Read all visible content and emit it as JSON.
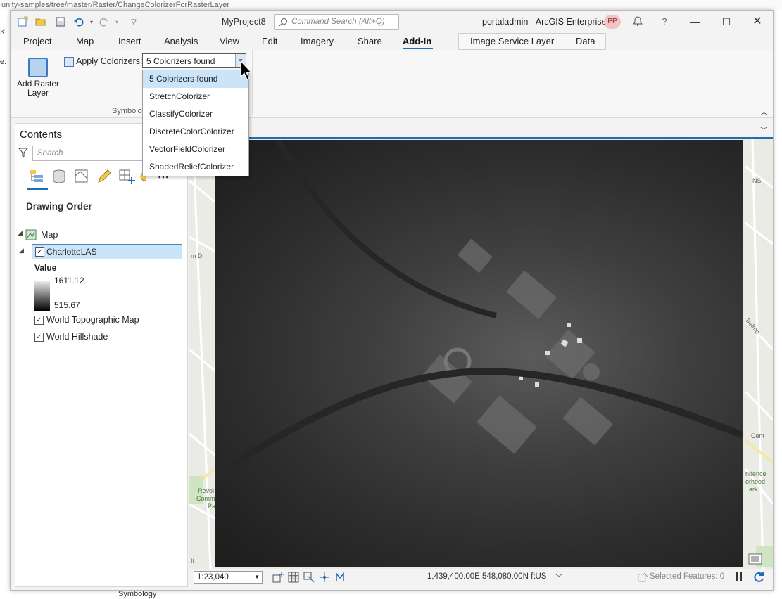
{
  "background": {
    "url_fragment": "unity-samples/tree/master/Raster/ChangeColorizerForRasterLayer",
    "left_edge_k": "K",
    "left_edge_e": "e.",
    "bottom_tab": "Symbology"
  },
  "titlebar": {
    "project": "MyProject8",
    "search_placeholder": "Command Search (Alt+Q)",
    "portal": "portaladmin - ArcGIS Enterprise",
    "avatar": "PP",
    "help": "?"
  },
  "tabs": [
    "Project",
    "Map",
    "Insert",
    "Analysis",
    "View",
    "Edit",
    "Imagery",
    "Share",
    "Add-In"
  ],
  "context_tabs": [
    "Image Service Layer",
    "Data"
  ],
  "ribbon": {
    "add_raster_label_1": "Add Raster",
    "add_raster_label_2": "Layer",
    "apply_label": "Apply Colorizers:",
    "combo_value": "5 Colorizers found",
    "group_label": "Symbolo"
  },
  "dropdown": [
    "5 Colorizers found",
    "StretchColorizer",
    "ClassifyColorizer",
    "DiscreteColorColorizer",
    "VectorFieldColorizer",
    "ShadedReliefColorizer"
  ],
  "contents": {
    "title": "Contents",
    "search_placeholder": "Search",
    "drawing_order": "Drawing Order",
    "map_label": "Map",
    "layer": "CharlotteLAS",
    "legend_title": "Value",
    "legend_high": "1611.12",
    "legend_low": "515.67",
    "basemap_1": "World Topographic Map",
    "basemap_2": "World Hillshade"
  },
  "map_labels": {
    "m_dr": "m Dr",
    "revol": "Revol",
    "comm": "Comm",
    "pa": "Pa",
    "if": "If",
    "belmont": "Belmo",
    "cent": "Cent",
    "ndence": "ndence",
    "orhood": "orhood",
    "ark": "ark",
    "ns": "NS"
  },
  "status": {
    "scale": "1:23,040",
    "coords": "1,439,400.00E 548,080.00N ftUS",
    "selected": "Selected Features: 0"
  },
  "colors": {
    "accent": "#1e6bb8",
    "selection": "#cce4f7",
    "avatar_bg": "#f4c3c3"
  }
}
